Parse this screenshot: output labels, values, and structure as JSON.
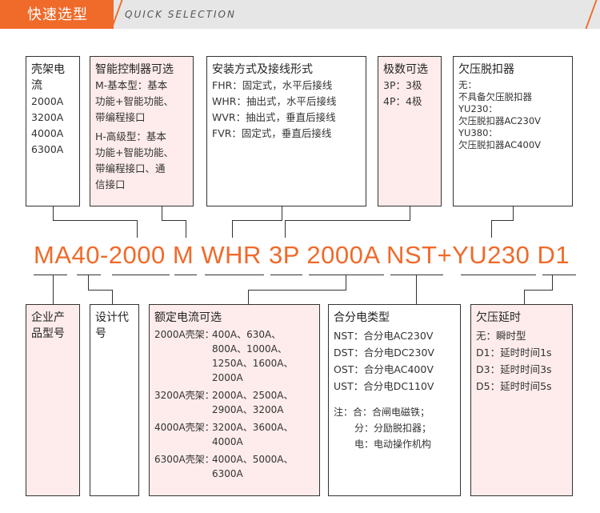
{
  "header": {
    "title": "快速选型",
    "subtitle": "QUICK SELECTION"
  },
  "code": "MA40-2000 M WHR 3P 2000A NST+YU230 D1",
  "top_boxes": [
    {
      "title": "壳架电流",
      "lines": [
        "2000A",
        "3200A",
        "4000A",
        "6300A"
      ]
    },
    {
      "title": "智能控制器可选",
      "lines": [
        "M-基本型：基本",
        "功能+智能功能、",
        "带编程接口",
        "H-高级型：基本",
        "功能+智能功能、",
        "带编程接口、通",
        "信接口"
      ]
    },
    {
      "title": "安装方式及接线形式",
      "lines": [
        "FHR：固定式，水平后接线",
        "WHR：抽出式，水平后接线",
        "WVR：抽出式，垂直后接线",
        "FVR：固定式，垂直后接线"
      ]
    },
    {
      "title": "极数可选",
      "lines": [
        "3P：3极",
        "4P：4极"
      ]
    },
    {
      "title": "欠压脱扣器",
      "lines": [
        "无：",
        "不具备欠压脱扣器",
        "YU230：",
        "欠压脱扣器AC230V",
        "YU380：",
        "欠压脱扣器AC400V"
      ]
    }
  ],
  "bottom_boxes": {
    "company": {
      "title": "企业产品型号"
    },
    "design": {
      "title": "设计代号"
    },
    "rated": {
      "title": "额定电流可选",
      "rows": [
        {
          "k": "2000A壳架：",
          "v": "400A、630A、800A、1000A、1250A、1600A、2000A"
        },
        {
          "k": "3200A壳架：",
          "v": "2000A、2500A、2900A、3200A"
        },
        {
          "k": "4000A壳架：",
          "v": "3200A、3600A、4000A"
        },
        {
          "k": "6300A壳架：",
          "v": "4000A、5000A、6300A"
        }
      ]
    },
    "closing": {
      "title": "合分电类型",
      "lines": [
        "NST：合分电AC230V",
        "DST：合分电DC230V",
        "OST：合分电AC400V",
        "UST：合分电DC110V"
      ],
      "notes": [
        "注：合：合闸电磁铁；",
        "分：分励脱扣器；",
        "电：电动操作机构"
      ]
    },
    "delay": {
      "title": "欠压延时",
      "lines": [
        "无：瞬时型",
        "D1：延时时间1s",
        "D3：延时时间3s",
        "D5：延时时间5s"
      ]
    }
  }
}
